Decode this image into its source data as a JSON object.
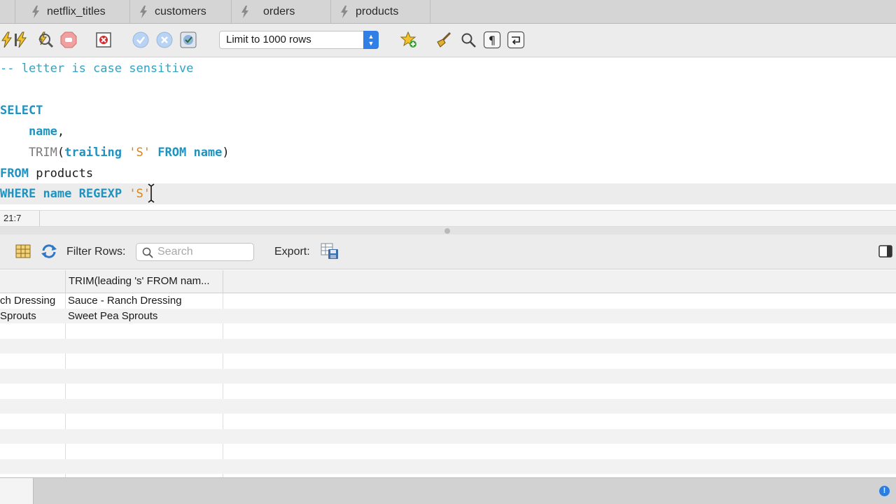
{
  "tabs": [
    {
      "label": "netflix_titles"
    },
    {
      "label": "customers"
    },
    {
      "label": "orders"
    },
    {
      "label": "products"
    }
  ],
  "toolbar": {
    "limit_select": "Limit to 1000 rows",
    "icons": [
      "execute-icon",
      "execute-current-icon",
      "explain-icon",
      "stop-icon",
      "stop-on-error-icon",
      "commit-icon",
      "rollback-icon",
      "autocommit-icon",
      "add-snippet-icon",
      "beautify-icon",
      "find-icon",
      "invisible-chars-icon",
      "wrap-lines-icon"
    ]
  },
  "editor": {
    "lines": [
      {
        "tokens": [
          {
            "t": "-- letter is case sensitive",
            "c": "cmt"
          }
        ]
      },
      {
        "tokens": [
          {
            "t": "SELECT",
            "c": "kw"
          }
        ]
      },
      {
        "tokens": [
          {
            "t": "    name",
            "c": "kw"
          },
          {
            "t": ",",
            "c": "plain"
          }
        ]
      },
      {
        "tokens": [
          {
            "t": "    TRIM",
            "c": "fn"
          },
          {
            "t": "(",
            "c": "plain"
          },
          {
            "t": "trailing",
            "c": "kw"
          },
          {
            "t": " ",
            "c": "plain"
          },
          {
            "t": "'S'",
            "c": "str"
          },
          {
            "t": " ",
            "c": "plain"
          },
          {
            "t": "FROM",
            "c": "kw"
          },
          {
            "t": " ",
            "c": "plain"
          },
          {
            "t": "name",
            "c": "kw"
          },
          {
            "t": ")",
            "c": "plain"
          }
        ]
      },
      {
        "tokens": [
          {
            "t": "FROM",
            "c": "kw"
          },
          {
            "t": " products",
            "c": "plain"
          }
        ]
      },
      {
        "tokens": [
          {
            "t": "WHERE",
            "c": "kw"
          },
          {
            "t": " ",
            "c": "plain"
          },
          {
            "t": "name",
            "c": "kw"
          },
          {
            "t": " ",
            "c": "plain"
          },
          {
            "t": "REGEXP",
            "c": "kw"
          },
          {
            "t": " ",
            "c": "plain"
          },
          {
            "t": "'S'",
            "c": "str"
          }
        ]
      }
    ],
    "cursor_position": "21:7"
  },
  "results": {
    "filter_label": "Filter Rows:",
    "search_placeholder": "Search",
    "export_label": "Export:",
    "columns": [
      "",
      "TRIM(leading 's' FROM nam..."
    ],
    "rows": [
      [
        "ch Dressing",
        "Sauce - Ranch Dressing"
      ],
      [
        "Sprouts",
        "Sweet Pea Sprouts"
      ]
    ]
  },
  "colors": {
    "keyword": "#1d93c2",
    "comment": "#2fa3c3",
    "string": "#d3861b",
    "select_accent": "#2f7fe6"
  }
}
